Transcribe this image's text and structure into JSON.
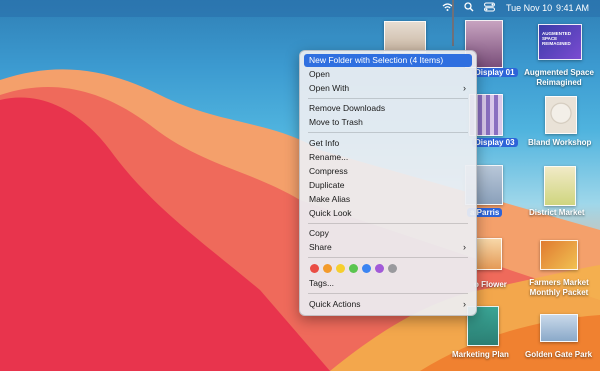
{
  "menubar": {
    "date": "Tue Nov 10",
    "time": "9:41 AM"
  },
  "desktop_items": [
    {
      "label": "Display 01",
      "selected": true
    },
    {
      "label": "Augmented Space Reimagined",
      "selected": false,
      "thumb_text": "AUGMENTED SPACE REIMAGINED"
    },
    {
      "label": "Display 03",
      "selected": true
    },
    {
      "label": "Bland Workshop",
      "selected": false
    },
    {
      "label": "a Parris",
      "selected": true
    },
    {
      "label": "District Market",
      "selected": false
    },
    {
      "label": "o Flower",
      "selected": false
    },
    {
      "label": "Farmers Market Monthly Packet",
      "selected": false
    },
    {
      "label": "Marketing Plan",
      "selected": false
    },
    {
      "label": "Golden Gate Park",
      "selected": false
    }
  ],
  "context_menu": {
    "items": [
      {
        "label": "New Folder with Selection (4 Items)",
        "highlighted": true
      },
      {
        "label": "Open"
      },
      {
        "label": "Open With",
        "submenu": true
      },
      {
        "label": "Remove Downloads"
      },
      {
        "label": "Move to Trash"
      },
      {
        "label": "Get Info"
      },
      {
        "label": "Rename..."
      },
      {
        "label": "Compress"
      },
      {
        "label": "Duplicate"
      },
      {
        "label": "Make Alias"
      },
      {
        "label": "Quick Look"
      },
      {
        "label": "Copy"
      },
      {
        "label": "Share",
        "submenu": true
      },
      {
        "label": "Tags..."
      },
      {
        "label": "Quick Actions",
        "submenu": true
      }
    ],
    "tag_colors": [
      "#ea4d45",
      "#f39a2b",
      "#f6cf2e",
      "#5bc54f",
      "#3b84f2",
      "#a25ad8",
      "#9a9a9e"
    ],
    "submenu_arrow": "›"
  },
  "colors": {
    "highlight": "#2f6fe0",
    "selection_label": "#2d64d8"
  },
  "icons": [
    "wifi-icon",
    "search-icon",
    "control-center-icon"
  ]
}
